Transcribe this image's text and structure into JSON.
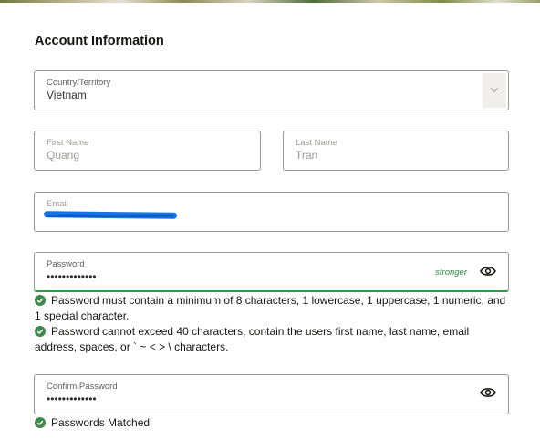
{
  "form": {
    "heading": "Account Information",
    "country": {
      "label": "Country/Territory",
      "value": "Vietnam"
    },
    "first_name": {
      "label": "First Name",
      "value": "Quang"
    },
    "last_name": {
      "label": "Last Name",
      "value": "Tran"
    },
    "email": {
      "label": "Email"
    },
    "password": {
      "label": "Password",
      "value": "•••••••••••••",
      "strength": "stronger"
    },
    "password_rules": [
      "Password must contain a minimum of 8 characters, 1 lowercase, 1 uppercase, 1 numeric, and 1 special character.",
      "Password cannot exceed 40 characters, contain the users first name, last name, email address, spaces, or ` ~ < > \\ characters."
    ],
    "confirm_password": {
      "label": "Confirm Password",
      "value": "•••••••••••••"
    },
    "match_message": "Passwords Matched"
  },
  "colors": {
    "valid_green": "#2a9d4a",
    "check_green": "#3e8a4e",
    "redaction_blue": "#1473e6"
  },
  "icons": {
    "country_dropdown": "chevron-down-icon",
    "password_toggle": "eye-icon",
    "confirm_toggle": "eye-icon",
    "rule_status": "check-circle-icon"
  }
}
